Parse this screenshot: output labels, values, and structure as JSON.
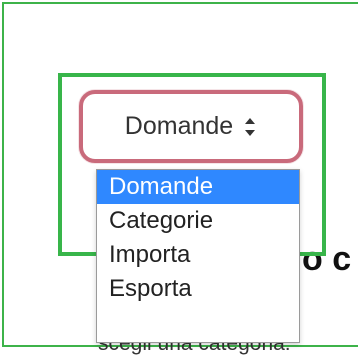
{
  "page": {
    "background_heading_fragment": "o c",
    "background_subtext_fragment": "scegli una categoria:"
  },
  "select": {
    "current_value": "Domande"
  },
  "dropdown": {
    "options": [
      {
        "label": "Domande",
        "selected": true
      },
      {
        "label": "Categorie",
        "selected": false
      },
      {
        "label": "Importa",
        "selected": false
      },
      {
        "label": "Esporta",
        "selected": false
      }
    ]
  },
  "icons": {
    "select_indicator": "chevron-up-down-icon"
  },
  "colors": {
    "frame_green": "#3db34a",
    "focus_pink": "#c96a7b",
    "selected_blue": "#2f88ff"
  }
}
